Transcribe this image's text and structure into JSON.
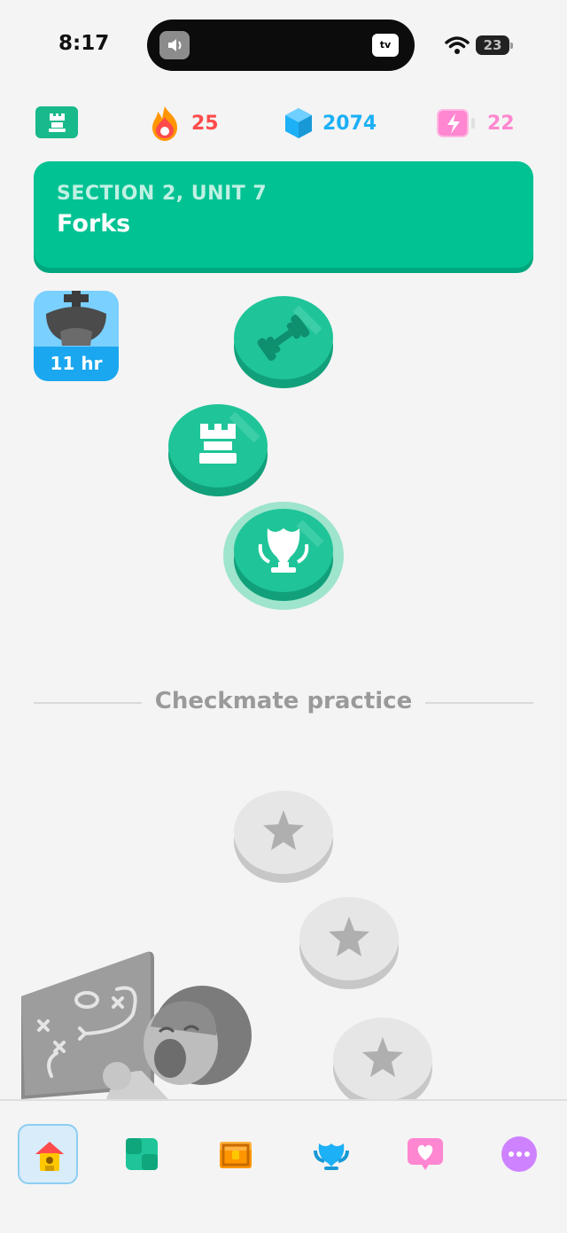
{
  "status_bar": {
    "time": "8:17",
    "tv_label": "tv",
    "battery_level": "23"
  },
  "top_stats": {
    "course_icon": "chess-rook-icon",
    "streak": {
      "icon": "flame-icon",
      "value": "25",
      "color": "#ff4b4b"
    },
    "gems": {
      "icon": "gem-icon",
      "value": "2074",
      "color": "#1cb0f6"
    },
    "energy": {
      "icon": "energy-battery-icon",
      "value": "22",
      "color": "#ff86d0"
    }
  },
  "unit_banner": {
    "section": "SECTION 2, UNIT 7",
    "title": "Forks",
    "color": "#00c293"
  },
  "timer_chest": {
    "icon": "chess-king-icon",
    "label": "11 hr"
  },
  "path_nodes": [
    {
      "icon": "dumbbell-icon",
      "state": "completed"
    },
    {
      "icon": "rook-icon",
      "state": "completed"
    },
    {
      "icon": "trophy-icon",
      "state": "current"
    },
    {
      "icon": "star-icon",
      "state": "locked"
    },
    {
      "icon": "star-icon",
      "state": "locked"
    },
    {
      "icon": "star-icon",
      "state": "locked"
    }
  ],
  "divider": {
    "label": "Checkmate practice"
  },
  "bottom_nav": [
    {
      "icon": "home-icon",
      "active": true
    },
    {
      "icon": "puzzle-board-icon",
      "active": false
    },
    {
      "icon": "treasure-chest-icon",
      "active": false
    },
    {
      "icon": "trophy-shield-icon",
      "active": false
    },
    {
      "icon": "heart-icon",
      "active": false
    },
    {
      "icon": "more-icon",
      "active": false
    }
  ]
}
